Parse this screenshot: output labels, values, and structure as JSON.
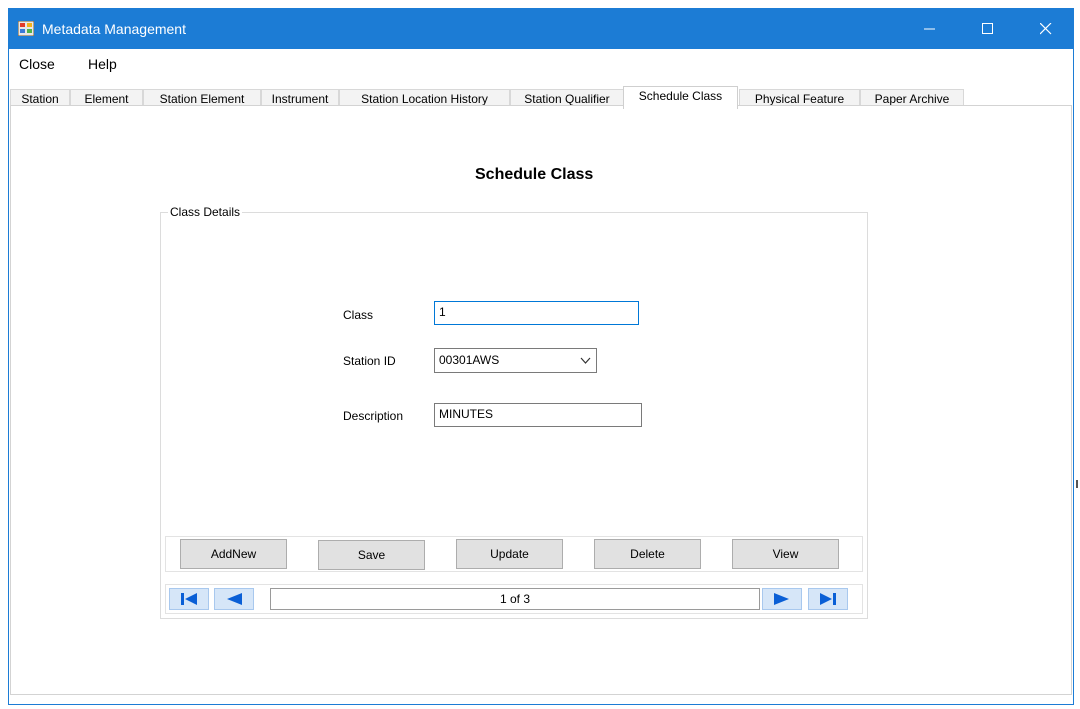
{
  "window": {
    "title": "Metadata Management"
  },
  "menu": [
    {
      "label": "Close"
    },
    {
      "label": "Help"
    }
  ],
  "tabs": [
    {
      "label": "Station"
    },
    {
      "label": "Element"
    },
    {
      "label": "Station Element"
    },
    {
      "label": "Instrument"
    },
    {
      "label": "Station Location History"
    },
    {
      "label": "Station Qualifier"
    },
    {
      "label": "Schedule Class",
      "active": true
    },
    {
      "label": "Physical Feature"
    },
    {
      "label": "Paper Archive"
    }
  ],
  "page": {
    "title": "Schedule Class",
    "group_label": "Class Details",
    "fields": {
      "class": {
        "label": "Class",
        "value": "1"
      },
      "station_id": {
        "label": "Station ID",
        "value": "00301AWS"
      },
      "description": {
        "label": "Description",
        "value": "MINUTES"
      }
    },
    "buttons": {
      "add_new": "AddNew",
      "save": "Save",
      "update": "Update",
      "delete": "Delete",
      "view": "View"
    },
    "navigator": {
      "position": "1 of 3"
    }
  },
  "colors": {
    "titlebar": "#1c7cd5",
    "nav_arrow": "#0a5fd6",
    "nav_button": "#d6e6f8"
  }
}
